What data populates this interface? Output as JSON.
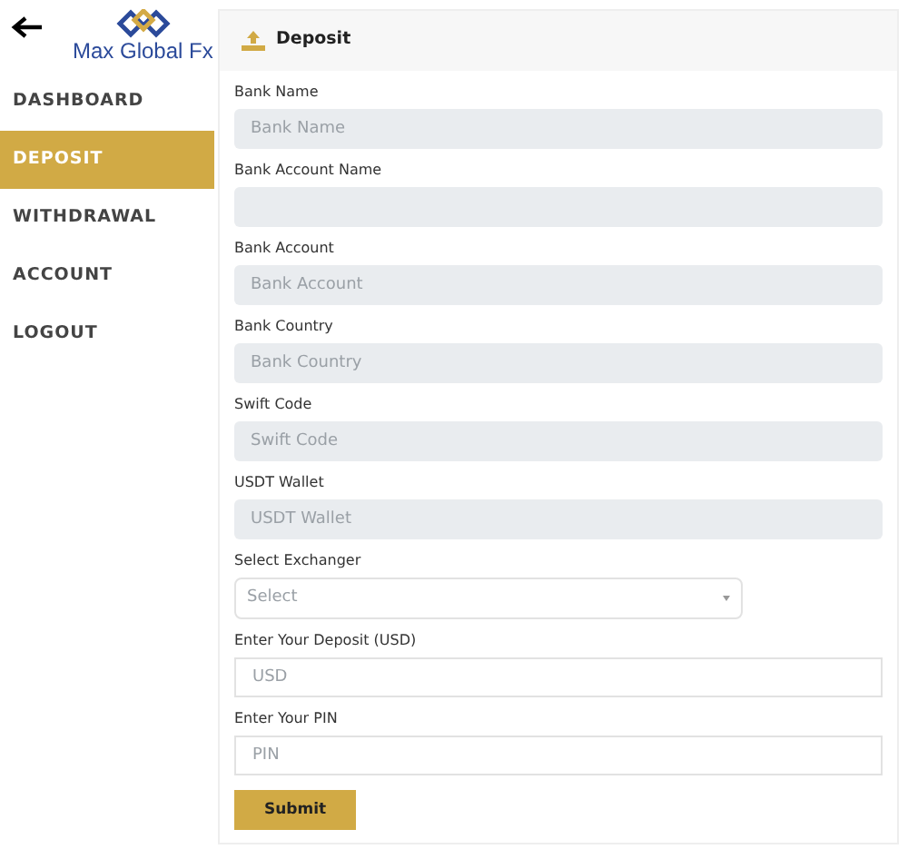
{
  "logo": {
    "text": "Max Global Fx"
  },
  "sidebar": {
    "items": [
      {
        "label": "DASHBOARD",
        "selected": false
      },
      {
        "label": "DEPOSIT",
        "selected": true
      },
      {
        "label": "WITHDRAWAL",
        "selected": false
      },
      {
        "label": "ACCOUNT",
        "selected": false
      },
      {
        "label": "LOGOUT",
        "selected": false
      }
    ]
  },
  "panel": {
    "title": "Deposit"
  },
  "fields": [
    {
      "kind": "readonly",
      "label": "Bank Name",
      "placeholder": "Bank Name"
    },
    {
      "kind": "readonly",
      "label": "Bank Account Name"
    },
    {
      "kind": "readonly",
      "label": "Bank Account",
      "placeholder": "Bank Account"
    },
    {
      "kind": "readonly",
      "label": "Bank Country",
      "placeholder": "Bank Country"
    },
    {
      "kind": "readonly",
      "label": "Swift Code",
      "placeholder": "Swift Code"
    },
    {
      "kind": "readonly",
      "label": "USDT Wallet",
      "placeholder": "USDT Wallet"
    },
    {
      "kind": "select",
      "label": "Select Exchanger",
      "placeholder": "Select"
    },
    {
      "kind": "text",
      "label": "Enter Your Deposit (USD)",
      "placeholder": "USD"
    },
    {
      "kind": "text",
      "label": "Enter Your PIN",
      "placeholder": "PIN"
    }
  ],
  "submit": {
    "label": "Submit"
  }
}
